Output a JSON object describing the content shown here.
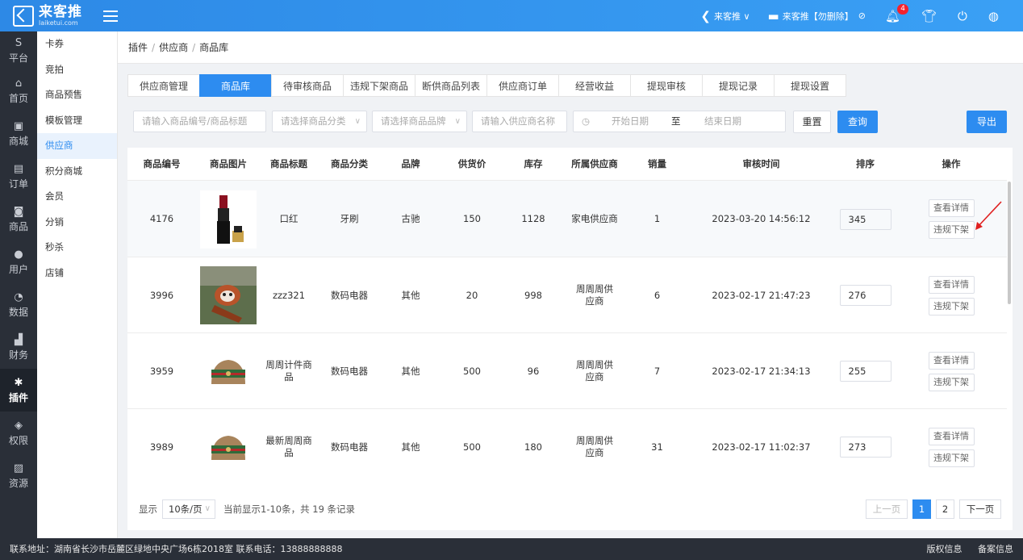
{
  "brand": {
    "name_cn": "来客推",
    "name_en": "laiketui.com"
  },
  "topbar": {
    "store_label": "来客推 ∨",
    "shop_label": "来客推【勿删除】",
    "notifications": "4"
  },
  "sidebar": [
    {
      "id": "platform",
      "label": "平台",
      "icon": "S"
    },
    {
      "id": "home",
      "label": "首页",
      "icon": "⌂"
    },
    {
      "id": "mall",
      "label": "商城",
      "icon": "▣"
    },
    {
      "id": "orders",
      "label": "订单",
      "icon": "▤"
    },
    {
      "id": "goods",
      "label": "商品",
      "icon": "◙"
    },
    {
      "id": "users",
      "label": "用户",
      "icon": "●"
    },
    {
      "id": "data",
      "label": "数据",
      "icon": "◔"
    },
    {
      "id": "finance",
      "label": "财务",
      "icon": "▟"
    },
    {
      "id": "plugins",
      "label": "插件",
      "icon": "✱"
    },
    {
      "id": "permissions",
      "label": "权限",
      "icon": "◈"
    },
    {
      "id": "resources",
      "label": "资源",
      "icon": "▨"
    }
  ],
  "submenu": [
    "卡券",
    "竞拍",
    "商品预售",
    "模板管理",
    "供应商",
    "积分商城",
    "会员",
    "分销",
    "秒杀",
    "店铺"
  ],
  "breadcrumb": [
    "插件",
    "供应商",
    "商品库"
  ],
  "tabs": [
    "供应商管理",
    "商品库",
    "待审核商品",
    "违规下架商品",
    "断供商品列表",
    "供应商订单",
    "经营收益",
    "提现审核",
    "提现记录",
    "提现设置"
  ],
  "filters": {
    "keyword_placeholder": "请输入商品编号/商品标题",
    "category_placeholder": "请选择商品分类",
    "brand_placeholder": "请选择商品品牌",
    "supplier_placeholder": "请输入供应商名称",
    "start_date": "开始日期",
    "to": "至",
    "end_date": "结束日期",
    "reset": "重置",
    "query": "查询",
    "export": "导出"
  },
  "table": {
    "headers": [
      "商品编号",
      "商品图片",
      "商品标题",
      "商品分类",
      "品牌",
      "供货价",
      "库存",
      "所属供应商",
      "销量",
      "审核时间",
      "排序",
      "操作"
    ],
    "rows": [
      {
        "id": "4176",
        "image": "lipstick",
        "title": "口红",
        "category": "牙刷",
        "brand": "古驰",
        "price": "150",
        "stock": "1128",
        "supplier": "家电供应商",
        "sales": "1",
        "time": "2023-03-20 14:56:12",
        "sort": "345"
      },
      {
        "id": "3996",
        "image": "red-panda",
        "title": "zzz321",
        "category": "数码电器",
        "brand": "其他",
        "price": "20",
        "stock": "998",
        "supplier": "周周周供应商",
        "sales": "6",
        "time": "2023-02-17 21:47:23",
        "sort": "276"
      },
      {
        "id": "3959",
        "image": "handbag",
        "title": "周周计件商品",
        "category": "数码电器",
        "brand": "其他",
        "price": "500",
        "stock": "96",
        "supplier": "周周周供应商",
        "sales": "7",
        "time": "2023-02-17 21:34:13",
        "sort": "255"
      },
      {
        "id": "3989",
        "image": "handbag",
        "title": "最新周周商品",
        "category": "数码电器",
        "brand": "其他",
        "price": "500",
        "stock": "180",
        "supplier": "周周周供应商",
        "sales": "31",
        "time": "2023-02-17 11:02:37",
        "sort": "273"
      }
    ],
    "actions": {
      "view": "查看详情",
      "offshelf": "违规下架"
    }
  },
  "pagination": {
    "show": "显示",
    "page_size": "10条/页",
    "summary": "当前显示1-10条，共 19 条记录",
    "prev": "上一页",
    "pages": [
      "1",
      "2"
    ],
    "next": "下一页"
  },
  "footer": {
    "address": "联系地址：湖南省长沙市岳麓区绿地中央广场6栋2018室 联系电话：13888888888",
    "copyright": "版权信息",
    "icp": "备案信息"
  },
  "colors": {
    "primary": "#2d8cf0",
    "sidebar": "#2a2f38",
    "annotation_arrow": "#e02020"
  }
}
